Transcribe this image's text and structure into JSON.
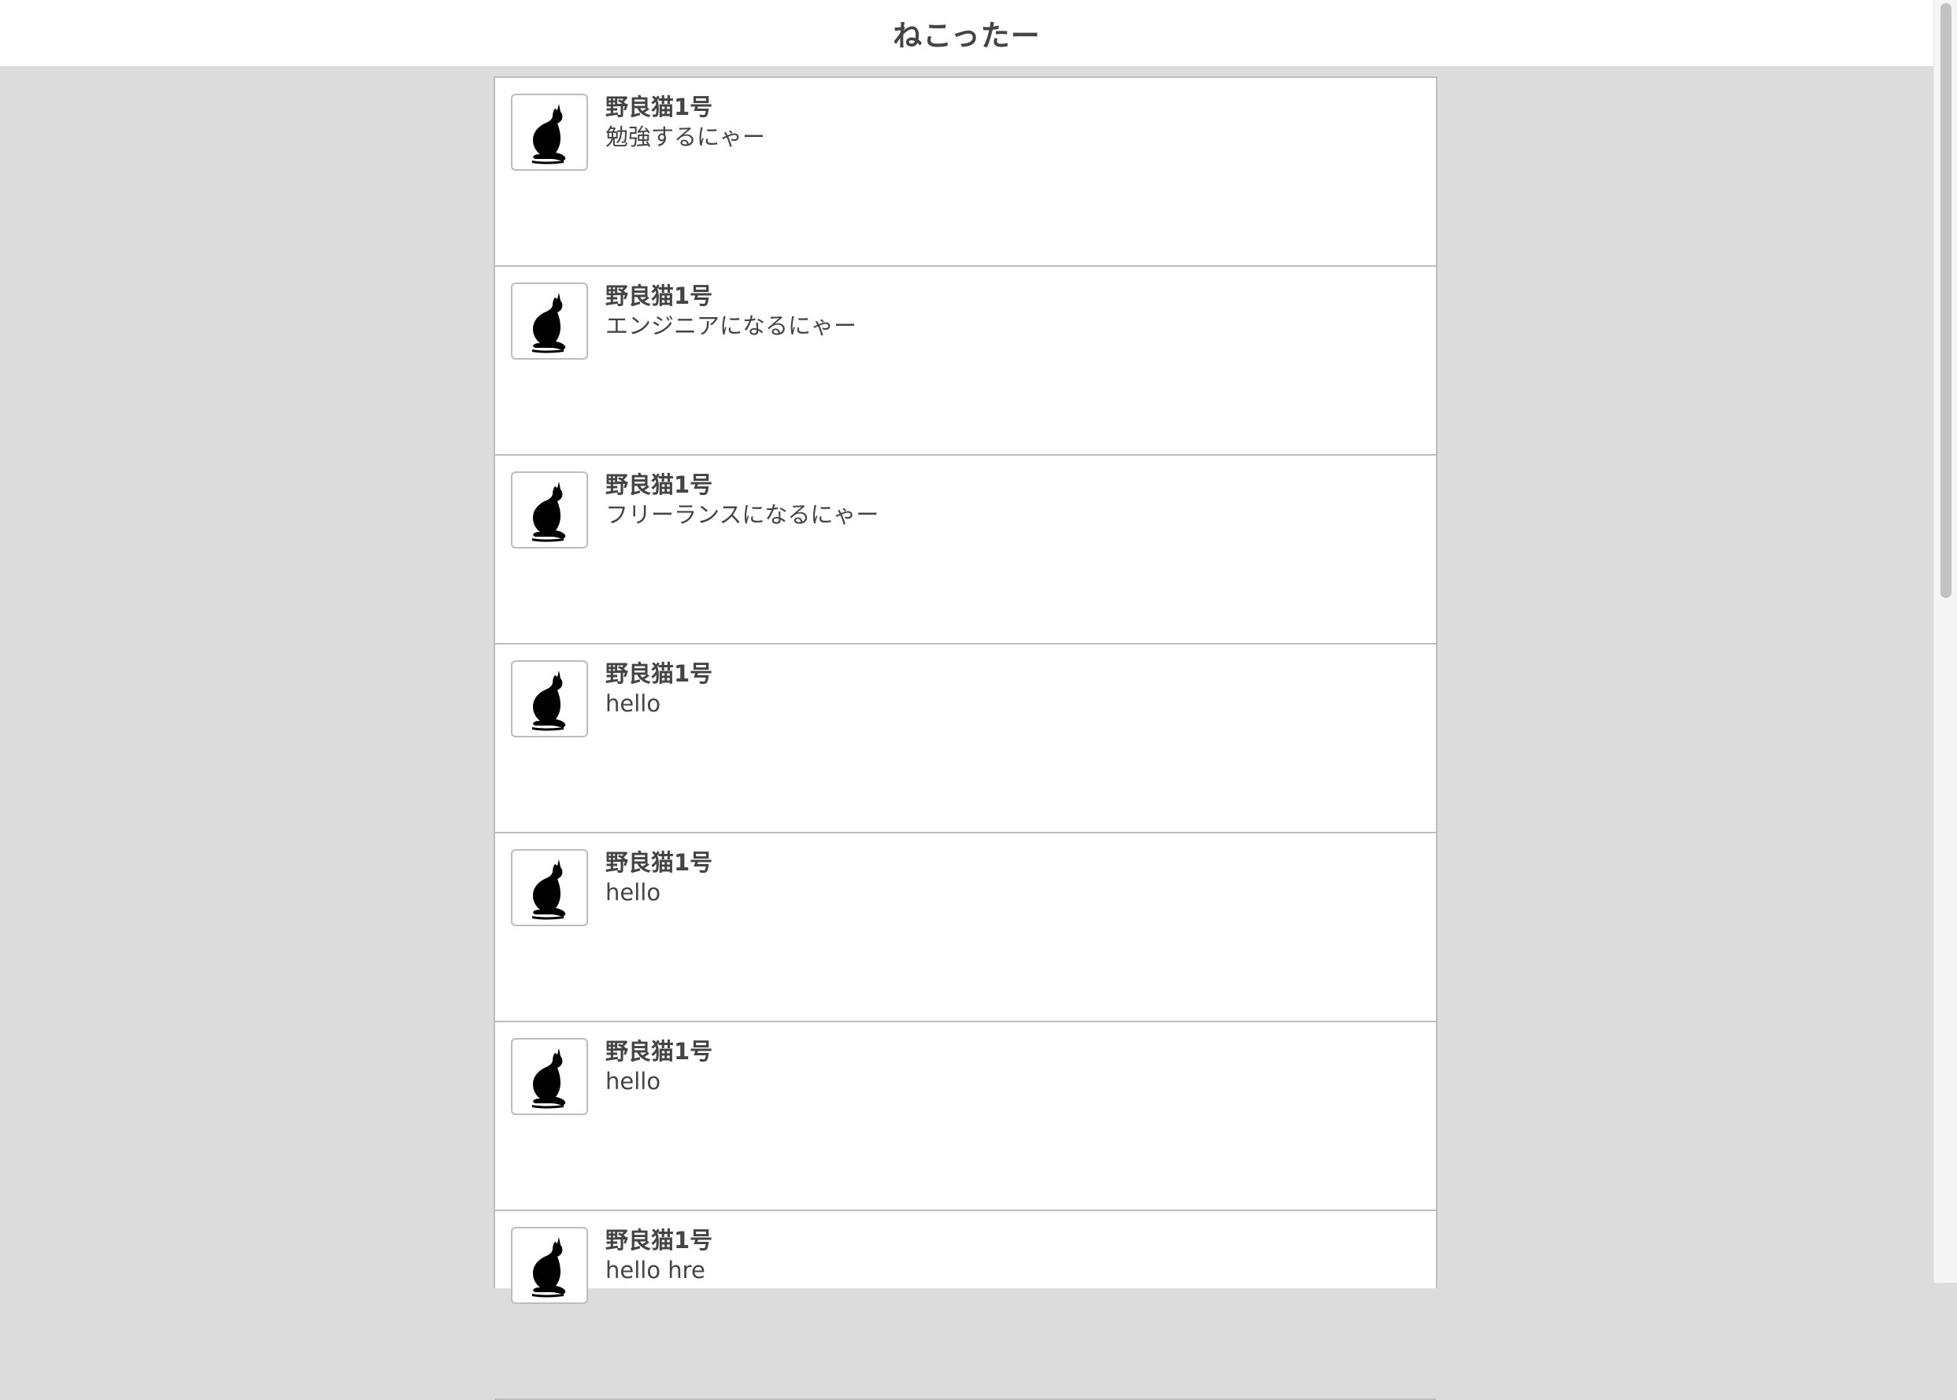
{
  "header": {
    "title": "ねこったー"
  },
  "posts": [
    {
      "username": "野良猫1号",
      "message": "勉強するにゃー",
      "avatar_icon": "cat-silhouette-icon"
    },
    {
      "username": "野良猫1号",
      "message": "エンジニアになるにゃー",
      "avatar_icon": "cat-silhouette-icon"
    },
    {
      "username": "野良猫1号",
      "message": "フリーランスになるにゃー",
      "avatar_icon": "cat-silhouette-icon"
    },
    {
      "username": "野良猫1号",
      "message": "hello",
      "avatar_icon": "cat-silhouette-icon"
    },
    {
      "username": "野良猫1号",
      "message": "hello",
      "avatar_icon": "cat-silhouette-icon"
    },
    {
      "username": "野良猫1号",
      "message": "hello",
      "avatar_icon": "cat-silhouette-icon"
    },
    {
      "username": "野良猫1号",
      "message": "hello hre",
      "avatar_icon": "cat-silhouette-icon"
    }
  ],
  "colors": {
    "page_background": "#dcdcdc",
    "card_background": "#ffffff",
    "border": "#bdbdbd",
    "text": "#444444"
  }
}
